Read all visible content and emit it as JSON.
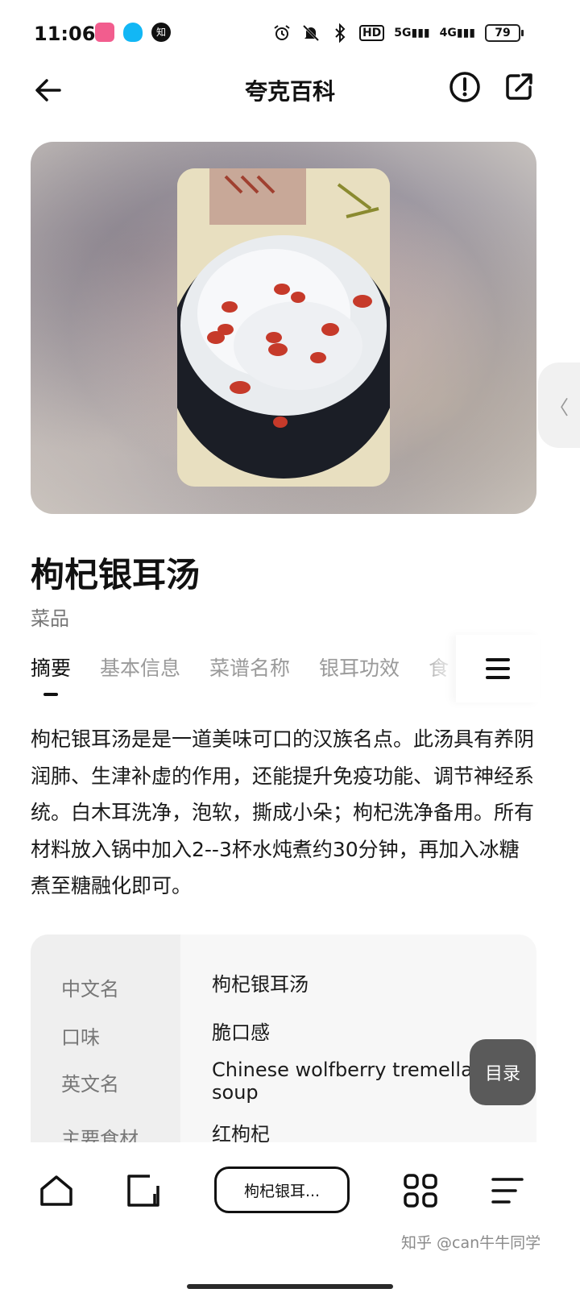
{
  "status_bar": {
    "time": "11:06",
    "zhihu_icon_text": "知",
    "network_5g": "5G",
    "network_4g": "4G",
    "hd_badge": "HD",
    "battery": "79"
  },
  "top_nav": {
    "title": "夸克百科"
  },
  "entry": {
    "title": "枸杞银耳汤",
    "category": "菜品"
  },
  "tabs": [
    {
      "label": "摘要",
      "active": true
    },
    {
      "label": "基本信息",
      "active": false
    },
    {
      "label": "菜谱名称",
      "active": false
    },
    {
      "label": "银耳功效",
      "active": false
    },
    {
      "label": "食",
      "active": false
    }
  ],
  "summary": "枸杞银耳汤是是一道美味可口的汉族名点。此汤具有养阴润肺、生津补虚的作用，还能提升免疫功能、调节神经系统。白木耳洗净，泡软，撕成小朵；枸杞洗净备用。所有材料放入锅中加入2--3杯水炖煮约30分钟，再加入冰糖煮至糖融化即可。",
  "info_table": [
    {
      "key": "中文名",
      "value": "枸杞银耳汤"
    },
    {
      "key": "口味",
      "value": "脆口感"
    },
    {
      "key": "英文名",
      "value": "Chinese wolfberry tremella soup"
    },
    {
      "key": "主要食材",
      "value": "红枸杞"
    }
  ],
  "toc_button": "目录",
  "side_handle": "〈",
  "bottom_nav": {
    "current_page_pill": "枸杞银耳..."
  },
  "watermark": "知乎 @can牛牛同学",
  "colors": {
    "accent": "#111111",
    "muted": "#9a9a9a",
    "toc_bg": "#5a5a5a"
  }
}
